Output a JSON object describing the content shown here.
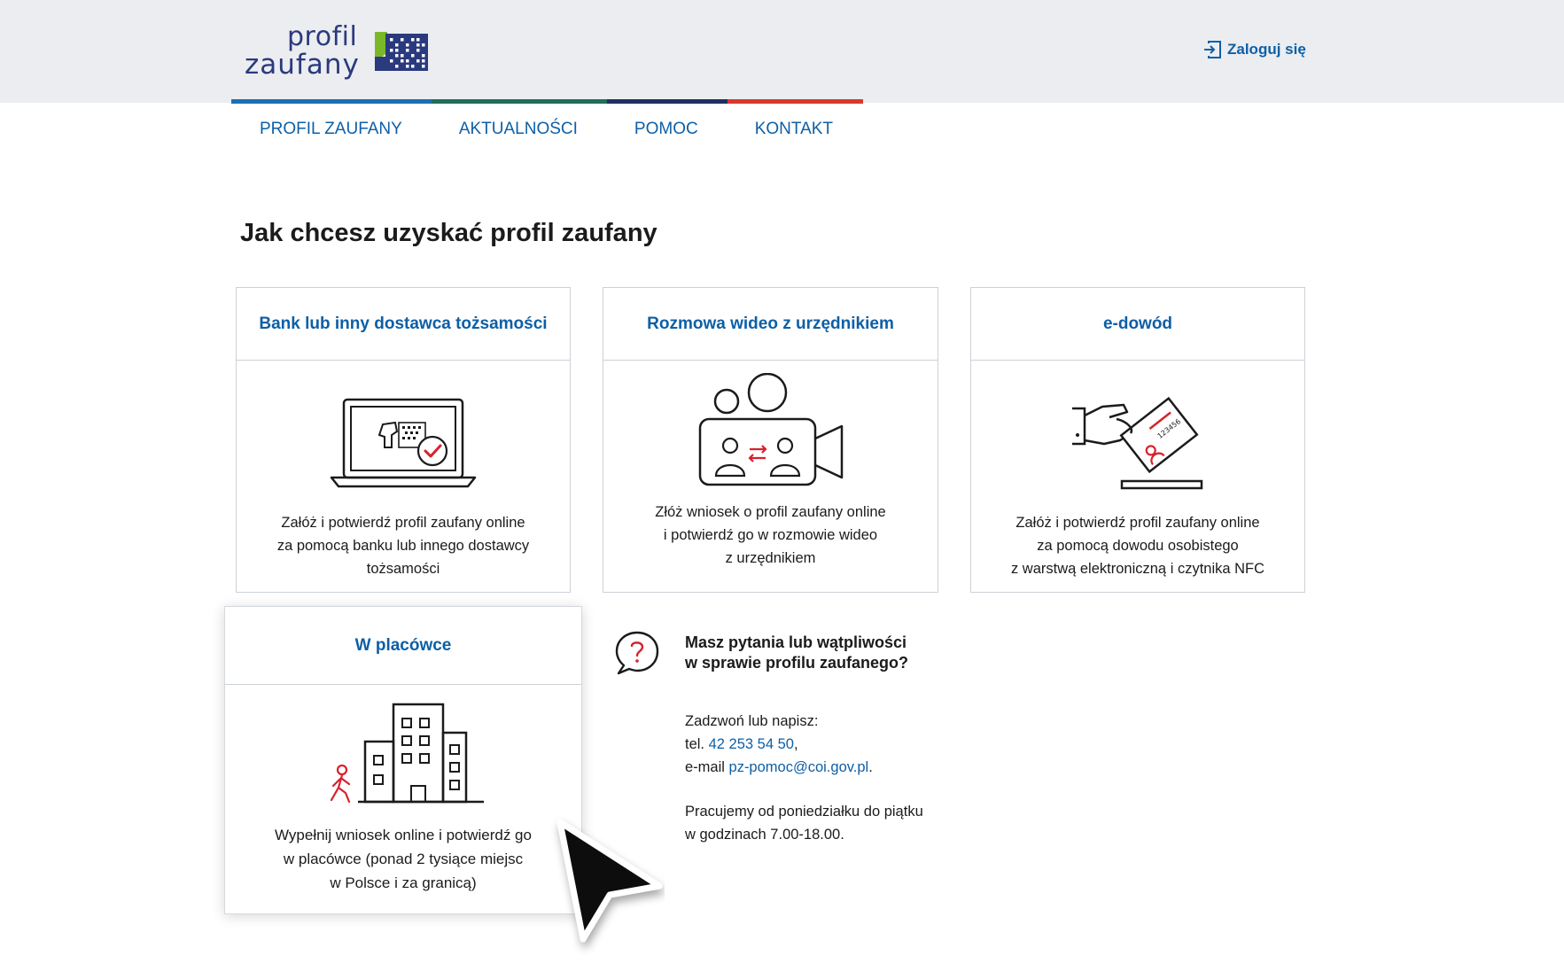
{
  "header": {
    "logo_line1": "profil",
    "logo_line2": "zaufany",
    "login_label": "Zaloguj się"
  },
  "nav": {
    "items": [
      "PROFIL ZAUFANY",
      "AKTUALNOŚCI",
      "POMOC",
      "KONTAKT"
    ]
  },
  "main": {
    "title": "Jak chcesz uzyskać profil zaufany",
    "cards": [
      {
        "title": "Bank lub inny dostawca tożsamości",
        "lines": [
          "Załóż i potwierdź profil zaufany online",
          "za pomocą banku lub innego dostawcy",
          "tożsamości"
        ],
        "icon": "laptop-verification-icon"
      },
      {
        "title": "Rozmowa wideo z urzędnikiem",
        "lines": [
          "Złóż wniosek o profil zaufany online",
          "i potwierdź go w rozmowie wideo",
          "z urzędnikiem"
        ],
        "icon": "video-call-icon"
      },
      {
        "title": "e-dowód",
        "lines": [
          "Załóż i potwierdź profil zaufany online",
          "za pomocą dowodu osobistego",
          "z warstwą elektroniczną i czytnika NFC"
        ],
        "icon": "id-card-reader-icon"
      },
      {
        "title": "W placówce",
        "lines": [
          "Wypełnij wniosek online i potwierdź go",
          "w placówce (ponad 2 tysiące miejsc",
          "w Polsce i za granicą)"
        ],
        "icon": "building-icon"
      }
    ]
  },
  "help": {
    "title_line1": "Masz pytania lub wątpliwości",
    "title_line2": "w sprawie profilu zaufanego?",
    "contact_intro": "Zadzwoń lub napisz:",
    "phone_prefix": "tel. ",
    "phone": "42 253 54 50",
    "phone_suffix": ",",
    "email_prefix": "e-mail ",
    "email": "pz-pomoc@coi.gov.pl",
    "email_suffix": ".",
    "hours_line1": "Pracujemy od poniedziałku do piątku",
    "hours_line2": "w godzinach 7.00-18.00."
  },
  "card_id_number": "123456",
  "colors": {
    "brand_blue": "#0d5fa6",
    "accent_red": "#d8382b",
    "logo_navy": "#2b3a7e",
    "logo_green": "#7ab829"
  }
}
